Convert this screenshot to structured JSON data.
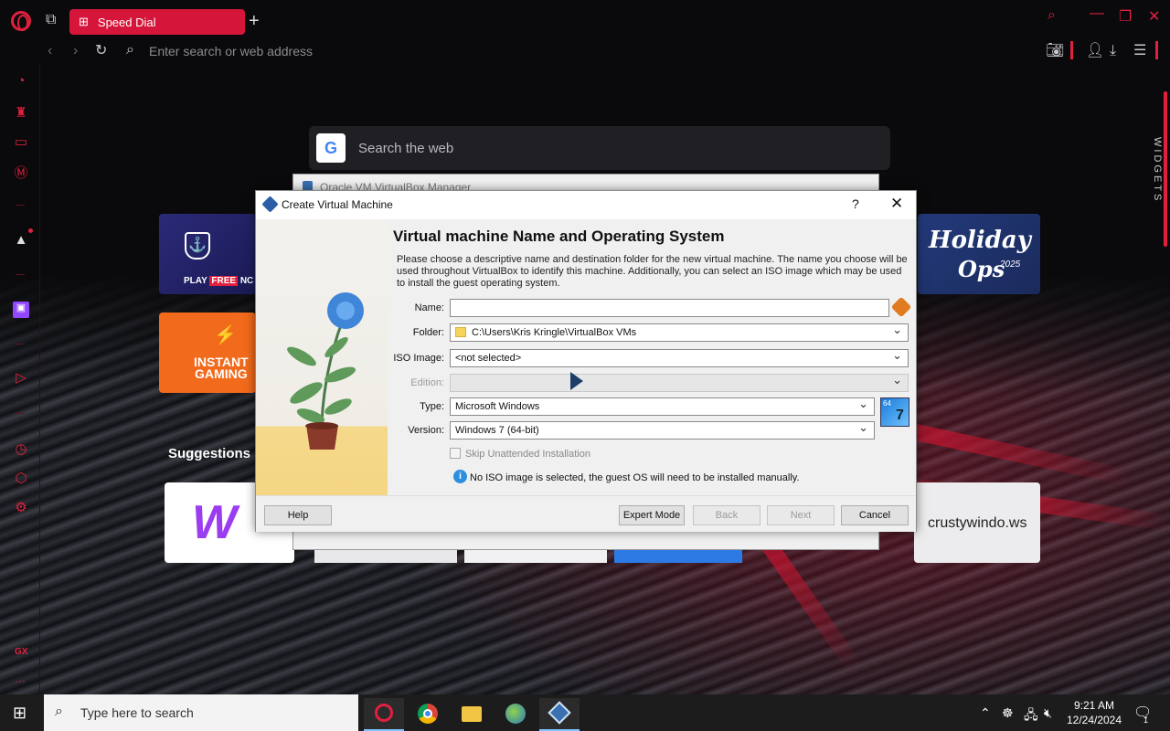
{
  "browser": {
    "tab_label": "Speed Dial",
    "address_placeholder": "Enter search or web address",
    "search_placeholder": "Search the web",
    "widgets_label": "WIDGETS",
    "suggestions_heading": "Suggestions",
    "tiles": {
      "wows_play": "PLAY",
      "wows_free": "FREE",
      "wows_tail": "NC",
      "instant_gaming_1": "INSTANT",
      "instant_gaming_2": "GAMING",
      "holiday_1": "Holiday",
      "holiday_2": "Ops",
      "holiday_year": "2025"
    },
    "suggestion_site": "crustywindo.ws",
    "sidebar_gx": "GX",
    "sidebar_more": "···"
  },
  "background_window": {
    "title": "Oracle VM VirtualBox Manager"
  },
  "dialog": {
    "title": "Create Virtual Machine",
    "help_glyph": "?",
    "close_glyph": "✕",
    "heading": "Virtual machine Name and Operating System",
    "description": "Please choose a descriptive name and destination folder for the new virtual machine. The name you choose will be used throughout VirtualBox to identify this machine. Additionally, you can select an ISO image which may be used to install the guest operating system.",
    "labels": {
      "name": "Name:",
      "folder": "Folder:",
      "iso": "ISO Image:",
      "edition": "Edition:",
      "type": "Type:",
      "version": "Version:"
    },
    "values": {
      "name": "",
      "folder": "C:\\Users\\Kris Kringle\\VirtualBox VMs",
      "iso": "<not selected>",
      "edition": "",
      "type": "Microsoft Windows",
      "version": "Windows 7 (64-bit)"
    },
    "os_badge_top": "64",
    "os_badge_num": "7",
    "skip_unattended": "Skip Unattended Installation",
    "info_text": "No ISO image is selected, the guest OS will need to be installed manually.",
    "buttons": {
      "help": "Help",
      "expert": "Expert Mode",
      "back": "Back",
      "next": "Next",
      "cancel": "Cancel"
    }
  },
  "taskbar": {
    "search_placeholder": "Type here to search",
    "time": "9:21 AM",
    "date": "12/24/2024",
    "notification_count": "1"
  },
  "colors": {
    "opera_red": "#e0203e",
    "tab_red": "#d5163a"
  }
}
